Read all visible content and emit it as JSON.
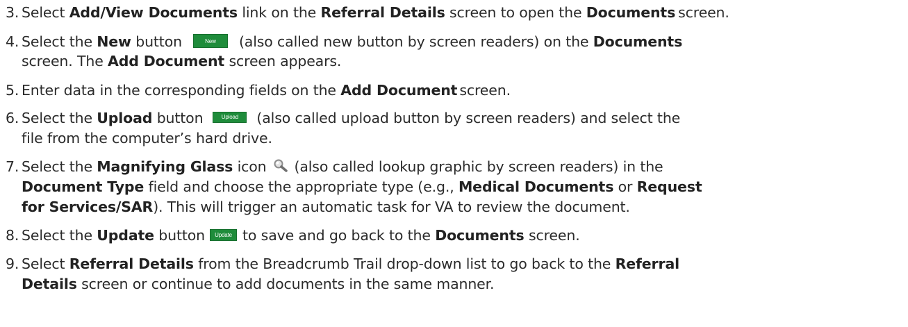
{
  "steps": [
    {
      "num": "3.",
      "line1": {
        "a": "Select ",
        "b1": "Add/View Documents",
        "c": " link on the ",
        "b2": "Referral Details",
        "d": " screen to open the ",
        "b3": "Documents",
        "e": "screen."
      }
    },
    {
      "num": "4.",
      "line1": {
        "a": "Select the ",
        "b1": "New",
        "c": " button",
        "btn": "New",
        "d": "(also called new button by screen readers) on the ",
        "b2": "Documents"
      },
      "line2": {
        "a": "screen. The ",
        "b1": "Add Document",
        "c": " screen appears."
      }
    },
    {
      "num": "5.",
      "line1": {
        "a": "Enter data in the corresponding fields on the ",
        "b1": "Add Document",
        "c": "screen."
      }
    },
    {
      "num": "6.",
      "line1": {
        "a": "Select the ",
        "b1": "Upload",
        "c": " button",
        "btn": "Upload",
        "d": "(also called upload button by screen readers) and select the"
      },
      "line2": {
        "a": "file from the computer’s hard drive."
      }
    },
    {
      "num": "7.",
      "line1": {
        "a": "Select the ",
        "b1": "Magnifying Glass",
        "c": " icon",
        "d": "(also called lookup graphic by screen readers) in the"
      },
      "line2": {
        "b1": "Document Type",
        "a": " field and choose the appropriate type (e.g., ",
        "b2": "Medical Documents",
        "c": " or ",
        "b3": "Request"
      },
      "line3": {
        "b1": "for Services/SAR",
        "a": "). This will trigger an automatic task for VA to review the document."
      }
    },
    {
      "num": "8.",
      "line1": {
        "a": "Select the ",
        "b1": "Update",
        "c": " button",
        "btn": "Update",
        "d": "to save and go back to the ",
        "b2": "Documents",
        "e": " screen."
      }
    },
    {
      "num": "9.",
      "line1": {
        "a": "Select ",
        "b1": "Referral Details",
        "c": " from the Breadcrumb Trail drop-down list to go back to the ",
        "b2": "Referral"
      },
      "line2": {
        "b1": "Details",
        "a": " screen or continue to add documents in the same manner."
      }
    }
  ],
  "icons": {
    "magnifier": "magnifying-glass-icon"
  },
  "colors": {
    "button_green": "#1f8c3b",
    "text": "#2b2b2b"
  }
}
